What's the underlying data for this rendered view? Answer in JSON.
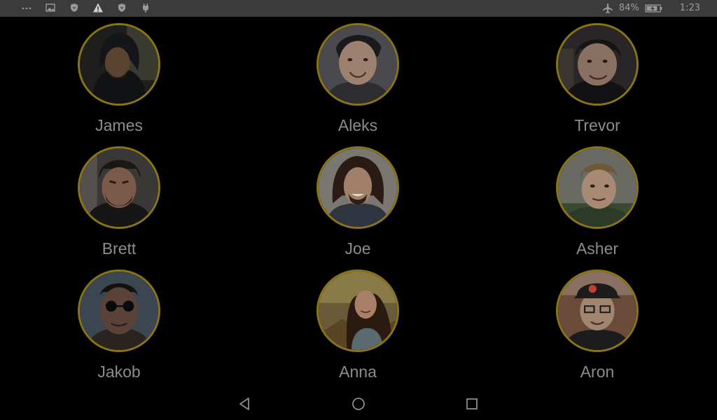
{
  "status_bar": {
    "left_icons": [
      "more-dots-icon",
      "image-icon",
      "shield-icon",
      "warning-icon",
      "shield-icon",
      "android-debug-icon"
    ],
    "battery_percent": "84%",
    "time": "1:23",
    "airplane_mode": true
  },
  "contacts": [
    {
      "name": "James",
      "avatar": "james-avatar"
    },
    {
      "name": "Aleks",
      "avatar": "aleks-avatar"
    },
    {
      "name": "Trevor",
      "avatar": "trevor-avatar"
    },
    {
      "name": "Brett",
      "avatar": "brett-avatar"
    },
    {
      "name": "Joe",
      "avatar": "joe-avatar"
    },
    {
      "name": "Asher",
      "avatar": "asher-avatar"
    },
    {
      "name": "Jakob",
      "avatar": "jakob-avatar"
    },
    {
      "name": "Anna",
      "avatar": "anna-avatar"
    },
    {
      "name": "Aron",
      "avatar": "aron-avatar"
    }
  ],
  "colors": {
    "ring": "#8a7419",
    "name_text": "#8c8c8c",
    "status_bar_bg": "#3b3b3b",
    "background": "#000000"
  },
  "nav_bar": {
    "buttons": [
      "back-icon",
      "home-icon",
      "recents-icon"
    ]
  }
}
